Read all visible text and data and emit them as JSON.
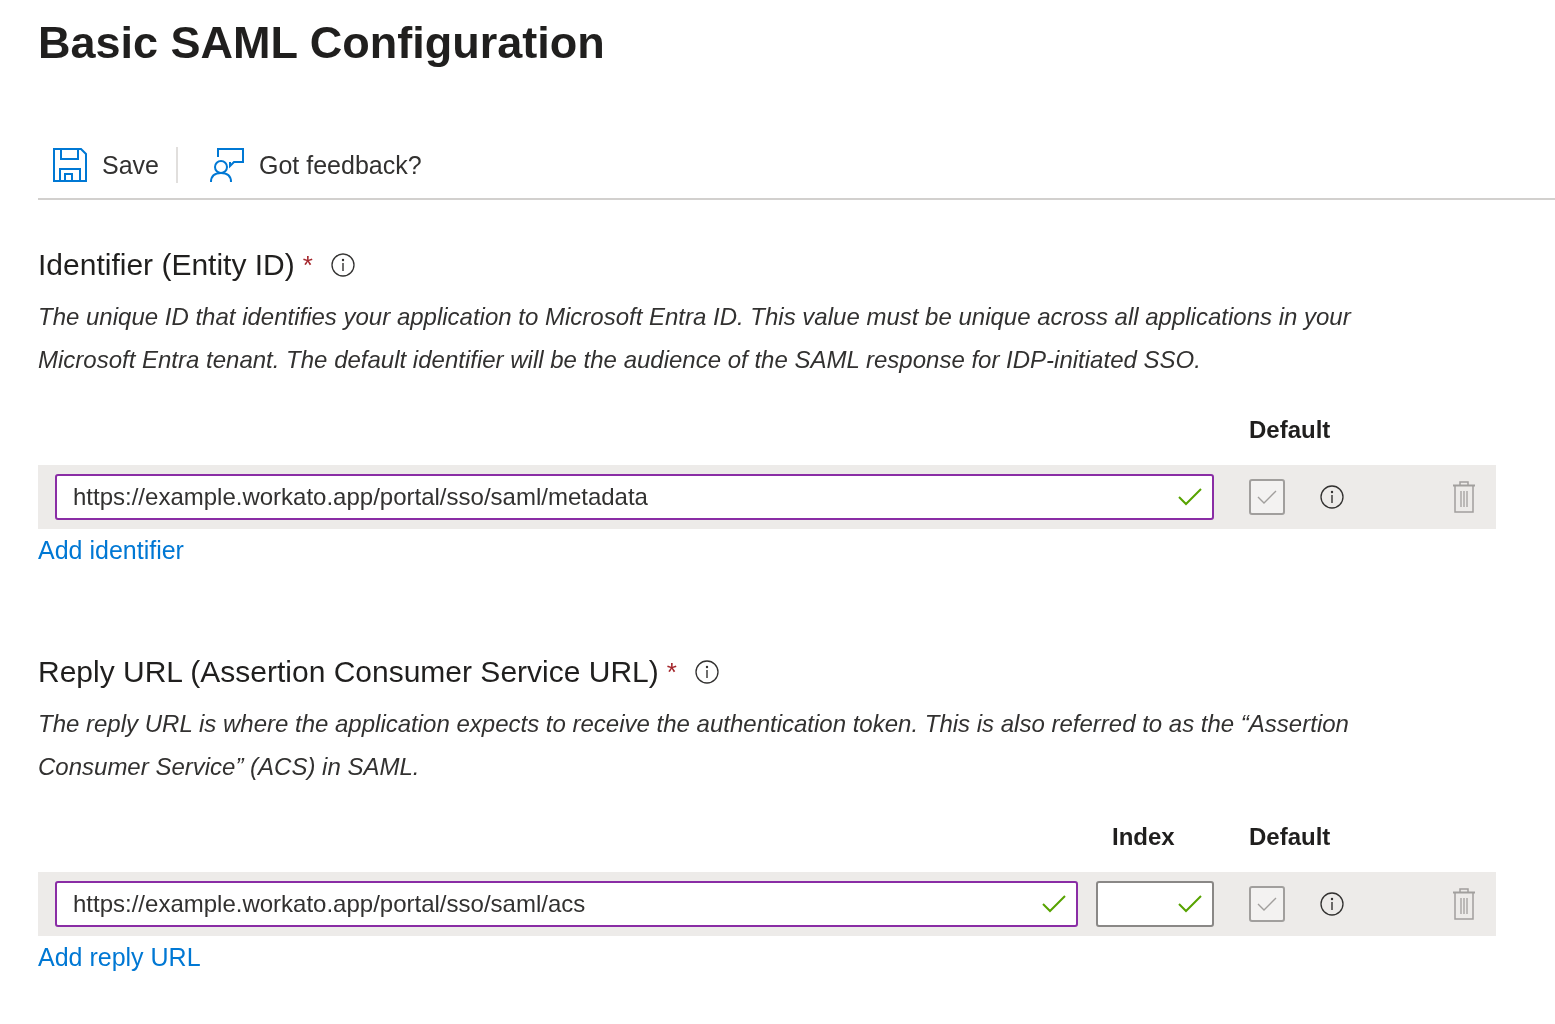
{
  "title": "Basic SAML Configuration",
  "toolbar": [
    {
      "kind": "save",
      "label": "Save"
    },
    {
      "kind": "feedback",
      "label": "Got feedback?"
    }
  ],
  "sections": [
    {
      "heading": "Identifier (Entity ID)",
      "required_mark": "*",
      "description": "The unique ID that identifies your application to Microsoft Entra ID. This value must be unique across all applications in your Microsoft Entra tenant. The default identifier will be the audience of the SAML response for IDP-initiated SSO.",
      "columns": [
        {
          "kind": "default",
          "label": "Default"
        }
      ],
      "rows": [
        {
          "url": {
            "value": "https://example.workato.app/portal/sso/saml/metadata",
            "valid": true,
            "highlighted": true
          },
          "default": {
            "checked": true,
            "disabled": true
          }
        }
      ],
      "add_link": "Add identifier"
    },
    {
      "heading": "Reply URL (Assertion Consumer Service URL)",
      "required_mark": "*",
      "description": "The reply URL is where the application expects to receive the authentication token. This is also referred to as the “Assertion Consumer Service” (ACS) in SAML.",
      "columns": [
        {
          "kind": "index",
          "label": "Index"
        },
        {
          "kind": "default",
          "label": "Default"
        }
      ],
      "rows": [
        {
          "url": {
            "value": "https://example.workato.app/portal/sso/saml/acs",
            "valid": true,
            "highlighted": true
          },
          "index": {
            "valid": true,
            "highlighted": false
          },
          "default": {
            "checked": true,
            "disabled": true
          }
        }
      ],
      "add_link": "Add reply URL"
    }
  ]
}
